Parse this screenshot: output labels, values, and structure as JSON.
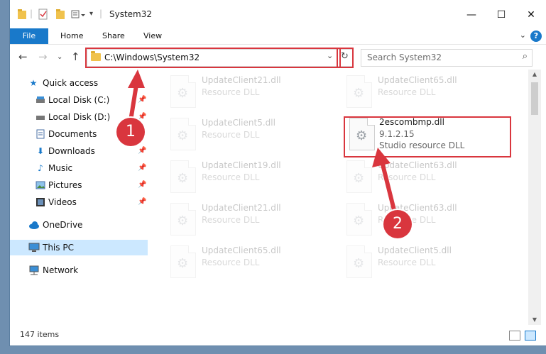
{
  "window": {
    "title": "System32",
    "controls": {
      "minimize": "—",
      "maximize": "☐",
      "close": "✕"
    }
  },
  "ribbon": {
    "tabs": [
      "File",
      "Home",
      "Share",
      "View"
    ],
    "help": "?"
  },
  "nav": {
    "address": "C:\\Windows\\System32",
    "search_placeholder": "Search System32"
  },
  "sidebar": {
    "items": [
      {
        "label": "Quick access",
        "icon": "star-icon"
      },
      {
        "label": "Local Disk (C:)",
        "icon": "drive-icon"
      },
      {
        "label": "Local Disk (D:)",
        "icon": "drive-icon"
      },
      {
        "label": "Documents",
        "icon": "documents-icon"
      },
      {
        "label": "Downloads",
        "icon": "downloads-icon"
      },
      {
        "label": "Music",
        "icon": "music-icon"
      },
      {
        "label": "Pictures",
        "icon": "pictures-icon"
      },
      {
        "label": "Videos",
        "icon": "videos-icon"
      },
      {
        "label": "OneDrive",
        "icon": "cloud-icon"
      },
      {
        "label": "This PC",
        "icon": "computer-icon"
      },
      {
        "label": "Network",
        "icon": "network-icon"
      }
    ]
  },
  "files": [
    {
      "name": "UpdateClient21.dll",
      "desc": "Resource DLL"
    },
    {
      "name": "UpdateClient65.dll",
      "desc": "Resource DLL"
    },
    {
      "name": "UpdateClient5.dll",
      "desc": "Resource DLL"
    },
    {
      "name": "2escombmp.dll",
      "version": "9.1.2.15",
      "desc": "Studio resource DLL"
    },
    {
      "name": "UpdateClient19.dll",
      "desc": "Resource DLL"
    },
    {
      "name": "UpdateClient63.dll",
      "desc": "Resource DLL"
    },
    {
      "name": "UpdateClient21.dll",
      "desc": "Resource DLL"
    },
    {
      "name": "UpdateClient63.dll",
      "desc": "Resource DLL"
    },
    {
      "name": "UpdateClient65.dll",
      "desc": "Resource DLL"
    },
    {
      "name": "UpdateClient5.dll",
      "desc": "Resource DLL"
    }
  ],
  "status": {
    "items_count": "147 items"
  },
  "callouts": [
    "1",
    "2"
  ],
  "colors": {
    "accent": "#1979ca",
    "highlight": "#d9363e",
    "selected": "#cce8ff"
  }
}
